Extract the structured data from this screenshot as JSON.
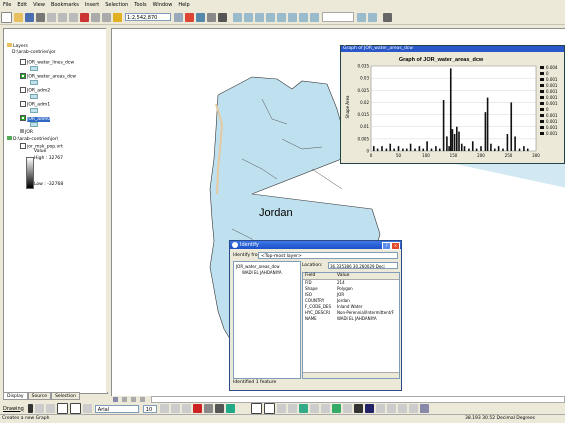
{
  "menu": [
    "File",
    "Edit",
    "View",
    "Bookmarks",
    "Insert",
    "Selection",
    "Tools",
    "Window",
    "Help"
  ],
  "toolbar": {
    "scale": "1:2,542,870"
  },
  "toc": {
    "layers_label": "Layers",
    "group1_path": "D:\\arab-contries\\jor",
    "layers": [
      {
        "name": "JOR_water_lines_dcw",
        "checked": false
      },
      {
        "name": "JOR_water_areas_dcw",
        "checked": true
      },
      {
        "name": "JOR_adm2",
        "checked": false
      },
      {
        "name": "JOR_adm1",
        "checked": false
      },
      {
        "name": "JOR_adm0",
        "checked": true,
        "selected": true
      }
    ],
    "extra_layer": "JOR",
    "group2_path": "D:\\arab-contries\\jor\\",
    "raster_name": "jor_msk_pop.vrt",
    "value_label": "Value",
    "high_label": "High : 32767",
    "low_label": "Low : -32768",
    "tabs": [
      "Display",
      "Source",
      "Selection"
    ]
  },
  "map": {
    "country_label": "Jordan"
  },
  "graph": {
    "window_title": "Graph of JOR_water_areas_dcw",
    "chart_title": "Graph of JOR_water_areas_dcw",
    "ylabel": "Shape Area",
    "legend": [
      "0.004",
      "0",
      "0.001",
      "0.001",
      "0.001",
      "0.001",
      "0.001",
      "0",
      "0.001",
      "0.001",
      "0.001",
      "0.001"
    ],
    "chart_data": {
      "type": "bar",
      "xlim": [
        0,
        300
      ],
      "ylim": [
        0,
        0.035
      ],
      "xticks": [
        "0",
        "50",
        "100",
        "150",
        "200",
        "250",
        "300"
      ],
      "yticks": [
        "0",
        "0.005",
        "0.01",
        "0.015",
        "0.02",
        "0.025",
        "0.03",
        "0.035"
      ],
      "x": [
        5,
        12,
        20,
        28,
        35,
        42,
        50,
        58,
        65,
        72,
        80,
        88,
        95,
        102,
        110,
        118,
        125,
        132,
        138,
        142,
        145,
        148,
        152,
        156,
        160,
        165,
        170,
        178,
        185,
        192,
        200,
        208,
        212,
        218,
        225,
        232,
        240,
        248,
        255,
        262,
        270,
        278,
        285
      ],
      "values": [
        0.002,
        0.001,
        0.002,
        0.001,
        0.003,
        0.001,
        0.002,
        0.001,
        0.001,
        0.003,
        0.001,
        0.002,
        0.001,
        0.004,
        0.001,
        0.002,
        0.001,
        0.021,
        0.006,
        0.002,
        0.034,
        0.009,
        0.007,
        0.01,
        0.008,
        0.003,
        0.002,
        0.001,
        0.004,
        0.001,
        0.002,
        0.016,
        0.022,
        0.003,
        0.001,
        0.002,
        0.001,
        0.007,
        0.02,
        0.006,
        0.001,
        0.002,
        0.001
      ],
      "grid": true
    }
  },
  "identify": {
    "title": "Identify",
    "identify_from_label": "Identify from:",
    "identify_from_value": "<Top-most layer>",
    "tree_layer": "JOR_water_areas_dcw",
    "tree_feature": "WADI EL JAHDANIYA",
    "location_label": "Location:",
    "location_value": "36.335386 30.260029 Deci",
    "field_header": "Field",
    "value_header": "Value",
    "rows": [
      [
        "FID",
        "214"
      ],
      [
        "Shape",
        "Polygon"
      ],
      [
        "ISO",
        "JOR"
      ],
      [
        "COUNTRY",
        "Jordan"
      ],
      [
        "F_CODE_DES",
        "Inland Water"
      ],
      [
        "HYC_DESCRI",
        "Non-Perennial/Intermittent/F"
      ],
      [
        "NAME",
        "WADI EL JAHDANIYA"
      ]
    ],
    "status": "Identified 1 feature"
  },
  "drawbar": {
    "drawing": "Drawing",
    "font": "Arial",
    "size": "10"
  },
  "status": {
    "left": "Creates a new Graph",
    "right": "38.193  30.52 Decimal Degrees"
  },
  "colors": {
    "water": "#bfe0ee",
    "accent": "#2a57c9"
  }
}
